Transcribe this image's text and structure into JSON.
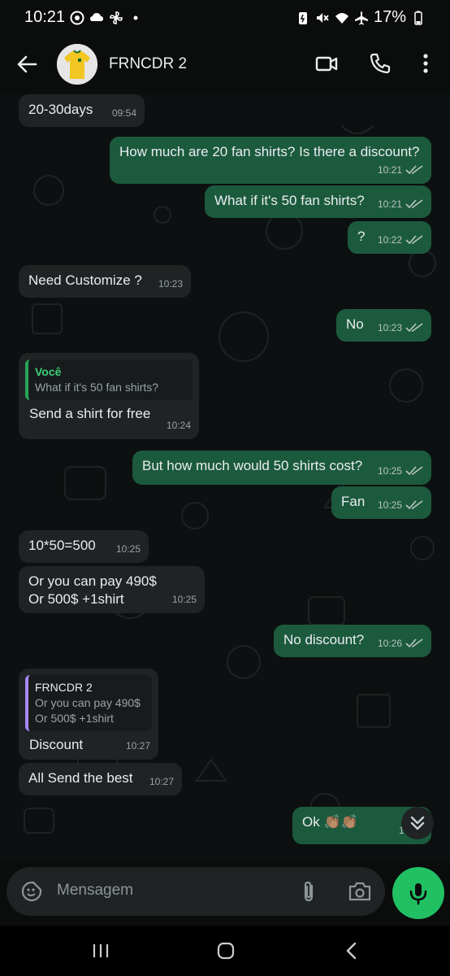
{
  "status_bar": {
    "time": "10:21",
    "battery": "17%",
    "left_icons": [
      "chrome-icon",
      "cloud-icon",
      "pinwheel-icon",
      "dot-icon"
    ],
    "right_icons": [
      "battery-saver-icon",
      "mute-icon",
      "wifi-icon",
      "airplane-icon",
      "battery-icon"
    ]
  },
  "header": {
    "title": "FRNCDR 2",
    "icons": [
      "back-arrow-icon",
      "video-call-icon",
      "phone-call-icon",
      "more-vertical-icon"
    ]
  },
  "colors": {
    "incoming_bubble": "#1f2324",
    "outgoing_bubble": "#1c5a3e",
    "accent_green": "#21c063",
    "read_ticks": "#b8c4bf"
  },
  "messages": [
    {
      "dir": "in",
      "text": "20-30days",
      "time": "09:54"
    },
    {
      "dir": "out",
      "text": "How much are 20 fan shirts? Is there a discount?",
      "time": "10:21"
    },
    {
      "dir": "out",
      "text": "What if it's 50 fan shirts?",
      "time": "10:21"
    },
    {
      "dir": "out",
      "text": "?",
      "time": "10:22"
    },
    {
      "dir": "in",
      "text": "Need Customize ?",
      "time": "10:23"
    },
    {
      "dir": "out",
      "text": "No",
      "time": "10:23"
    },
    {
      "dir": "in",
      "quote_author": "Você",
      "quote_text": "What if it's 50 fan shirts?",
      "text": "Send a shirt for free",
      "time": "10:24"
    },
    {
      "dir": "out",
      "text": "But how much would 50 shirts cost?",
      "time": "10:25"
    },
    {
      "dir": "out",
      "text": "Fan",
      "time": "10:25"
    },
    {
      "dir": "in",
      "text": "10*50=500",
      "time": "10:25"
    },
    {
      "dir": "in",
      "text": "Or you can pay 490$\nOr 500$ +1shirt",
      "time": "10:25"
    },
    {
      "dir": "out",
      "text": "No discount?",
      "time": "10:26"
    },
    {
      "dir": "in",
      "quote_author": "FRNCDR 2",
      "quote_text": "Or you can pay 490$\nOr 500$ +1shirt",
      "text": "Discount",
      "time": "10:27"
    },
    {
      "dir": "in",
      "text": "All Send the best",
      "time": "10:27"
    },
    {
      "dir": "out",
      "text": "Ok 👏🏽👏🏽",
      "time": "10:28"
    }
  ],
  "composer": {
    "placeholder": "Mensagem"
  }
}
